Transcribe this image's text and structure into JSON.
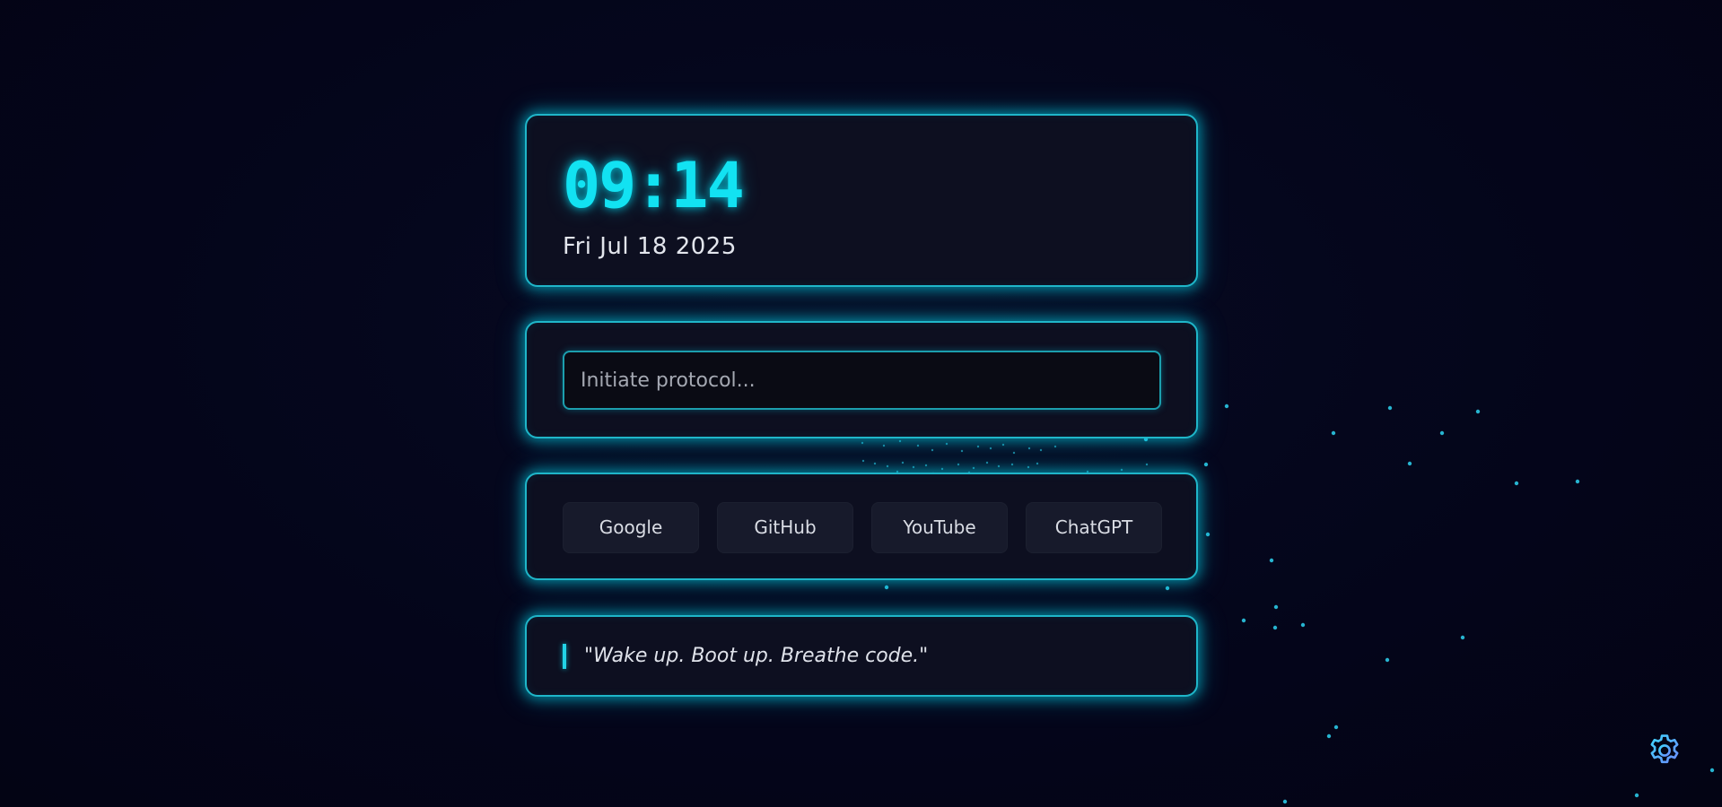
{
  "clock": {
    "time": "09:14",
    "date": "Fri Jul 18 2025"
  },
  "search": {
    "placeholder": "Initiate protocol..."
  },
  "links": [
    {
      "label": "Google"
    },
    {
      "label": "GitHub"
    },
    {
      "label": "YouTube"
    },
    {
      "label": "ChatGPT"
    }
  ],
  "quote": {
    "text": "\"Wake up. Boot up. Breathe code.\""
  },
  "settings": {
    "icon": "gear-icon"
  },
  "theme": {
    "background": "#04051a",
    "accent": "#12e2f2",
    "card_border": "#1fb6c9",
    "particle": "#2bc8e4"
  }
}
